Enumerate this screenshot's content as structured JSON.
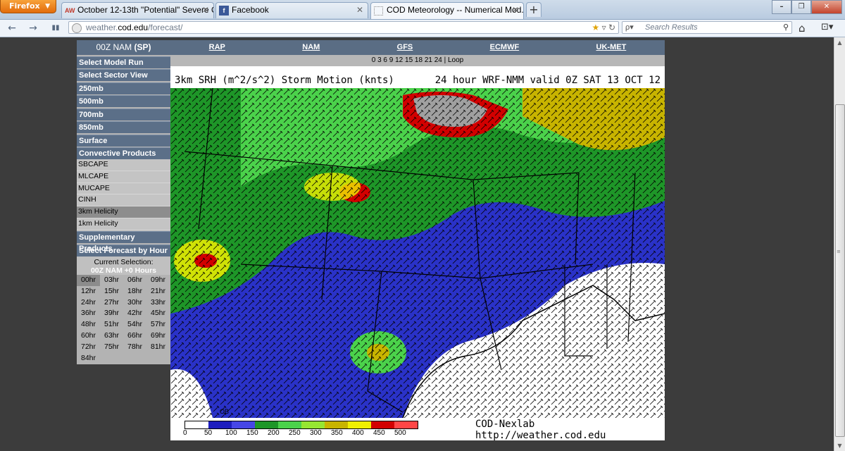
{
  "browser": {
    "menu_button": "Firefox",
    "tabs": [
      {
        "icon": "AW",
        "title": "October 12-13th \"Potential\" Severe O..."
      },
      {
        "icon": "f",
        "title": "Facebook"
      },
      {
        "icon": "",
        "title": "COD Meteorology -- Numerical Mod..."
      }
    ],
    "url_prefix": "weather.",
    "url_domain": "cod.edu",
    "url_path": "/forecast/",
    "search_placeholder": "Search Results",
    "window_buttons": [
      "–",
      "❐",
      "✕"
    ]
  },
  "sidebar": {
    "model_label": "00Z NAM",
    "sector_label": "(SP)",
    "buttons": {
      "model_run": "Select Model Run",
      "sector_view": "Select Sector View",
      "mb250": "250mb",
      "mb500": "500mb",
      "mb700": "700mb",
      "mb850": "850mb",
      "surface": "Surface",
      "convective": "Convective Products",
      "supplementary": "Supplementary Products",
      "forecast_hour": "Select Forecast by Hour"
    },
    "convective_items": [
      "SBCAPE",
      "MLCAPE",
      "MUCAPE",
      "CINH",
      "3km Helicity",
      "1km Helicity"
    ],
    "current_selection_label": "Current Selection:",
    "current_selection_value": "00Z NAM +0 Hours",
    "hours": [
      "00hr",
      "03hr",
      "06hr",
      "09hr",
      "12hr",
      "15hr",
      "18hr",
      "21hr",
      "24hr",
      "27hr",
      "30hr",
      "33hr",
      "36hr",
      "39hr",
      "42hr",
      "45hr",
      "48hr",
      "51hr",
      "54hr",
      "57hr",
      "60hr",
      "63hr",
      "66hr",
      "69hr",
      "72hr",
      "75hr",
      "78hr",
      "81hr",
      "84hr"
    ]
  },
  "top_nav": {
    "models": [
      "RAP",
      "NAM",
      "GFS",
      "ECMWF",
      "UK-MET"
    ],
    "hours_line": "0 3 6 9 12 15 18 21 24 | Loop"
  },
  "map": {
    "title_left": "3km SRH (m^2/s^2) Storm Motion (knts)",
    "title_right": "24 hour WRF-NMM valid 0Z SAT 13 OCT 12",
    "legend_values": [
      "0",
      "50",
      "100",
      "150",
      "200",
      "250",
      "300",
      "350",
      "400",
      "450",
      "500"
    ],
    "legend_colors": [
      "#ffffff",
      "#1e1ebe",
      "#4646e6",
      "#1e9628",
      "#4bd24b",
      "#96e632",
      "#c8b400",
      "#f0f000",
      "#d20000",
      "#ff4646"
    ],
    "credit": "COD-Nexlab http://weather.cod.edu",
    "corner_label": "OB"
  }
}
